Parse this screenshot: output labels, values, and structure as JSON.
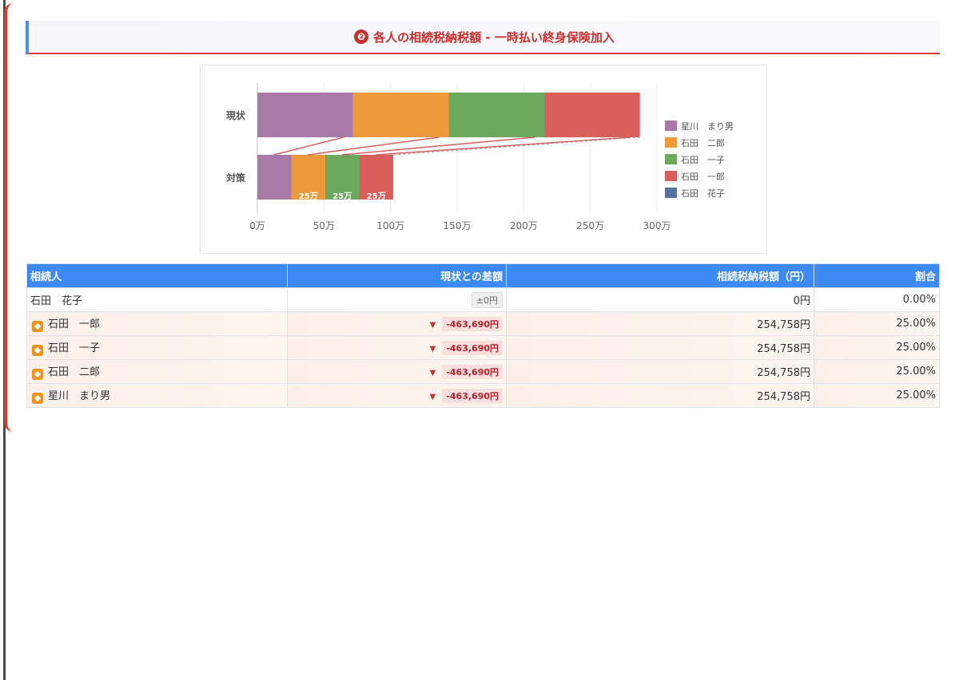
{
  "section": {
    "number": "❷",
    "title": "各人の相続税納税額 - 一時払い終身保険加入"
  },
  "colors": {
    "accent_red": "#c9302c",
    "header_blue": "#3d8af7"
  },
  "chart_data": {
    "type": "bar",
    "orientation": "horizontal-stacked",
    "categories": [
      "現状",
      "対策"
    ],
    "series": [
      {
        "name": "星川　まり男",
        "color": "#a87aa8",
        "values": [
          71.8,
          25.5
        ]
      },
      {
        "name": "石田　二郎",
        "color": "#ec9a3c",
        "values": [
          71.8,
          25.5
        ]
      },
      {
        "name": "石田　一子",
        "color": "#6ca95e",
        "values": [
          71.8,
          25.5
        ]
      },
      {
        "name": "石田　一郎",
        "color": "#d95f5c",
        "values": [
          71.8,
          25.5
        ]
      },
      {
        "name": "石田　花子",
        "color": "#5973a0",
        "values": [
          0,
          0
        ]
      }
    ],
    "xticks": [
      "0万",
      "50万",
      "100万",
      "150万",
      "200万",
      "250万",
      "300万"
    ],
    "xlim": [
      0,
      300
    ],
    "data_labels": [
      "25万",
      "25万",
      "25万"
    ],
    "legend_position": "right",
    "grid": true
  },
  "table": {
    "headers": {
      "name": "相続人",
      "diff": "現状との差額",
      "tax": "相続税納税額（円）",
      "ratio": "割合"
    },
    "rows": [
      {
        "name": "石田　花子",
        "diff": "±0円",
        "tax": "0円",
        "ratio": "0.00%",
        "icon": false,
        "negative": false
      },
      {
        "name": "石田　一郎",
        "diff": "-463,690円",
        "tax": "254,758円",
        "ratio": "25.00%",
        "icon": true,
        "negative": true
      },
      {
        "name": "石田　一子",
        "diff": "-463,690円",
        "tax": "254,758円",
        "ratio": "25.00%",
        "icon": true,
        "negative": true
      },
      {
        "name": "石田　二郎",
        "diff": "-463,690円",
        "tax": "254,758円",
        "ratio": "25.00%",
        "icon": true,
        "negative": true
      },
      {
        "name": "星川　まり男",
        "diff": "-463,690円",
        "tax": "254,758円",
        "ratio": "25.00%",
        "icon": true,
        "negative": true
      }
    ]
  }
}
